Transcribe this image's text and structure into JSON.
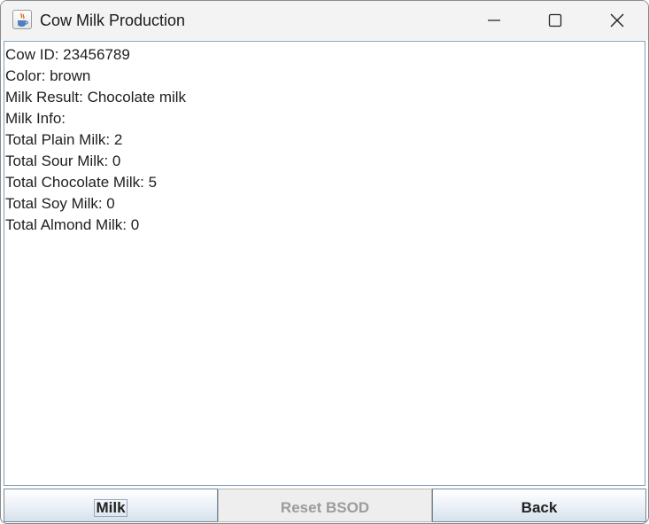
{
  "window": {
    "title": "Cow Milk Production",
    "icon": "java-coffee-cup-icon"
  },
  "title_controls": {
    "minimize_icon": "minimize-icon",
    "maximize_icon": "maximize-icon",
    "close_icon": "close-icon"
  },
  "output": {
    "lines": [
      "Cow ID: 23456789",
      "Color: brown",
      "Milk Result: Chocolate milk",
      "Milk Info:",
      "Total Plain Milk: 2",
      "Total Sour Milk: 0",
      "Total Chocolate Milk: 5",
      "Total Soy Milk: 0",
      "Total Almond Milk: 0"
    ]
  },
  "buttons": {
    "milk": "Milk",
    "reset": "Reset BSOD",
    "back": "Back"
  },
  "colors": {
    "titlebar_bg": "#f3f3f3",
    "text_border": "#7f9db9",
    "disabled_text": "#9c9c9c"
  }
}
